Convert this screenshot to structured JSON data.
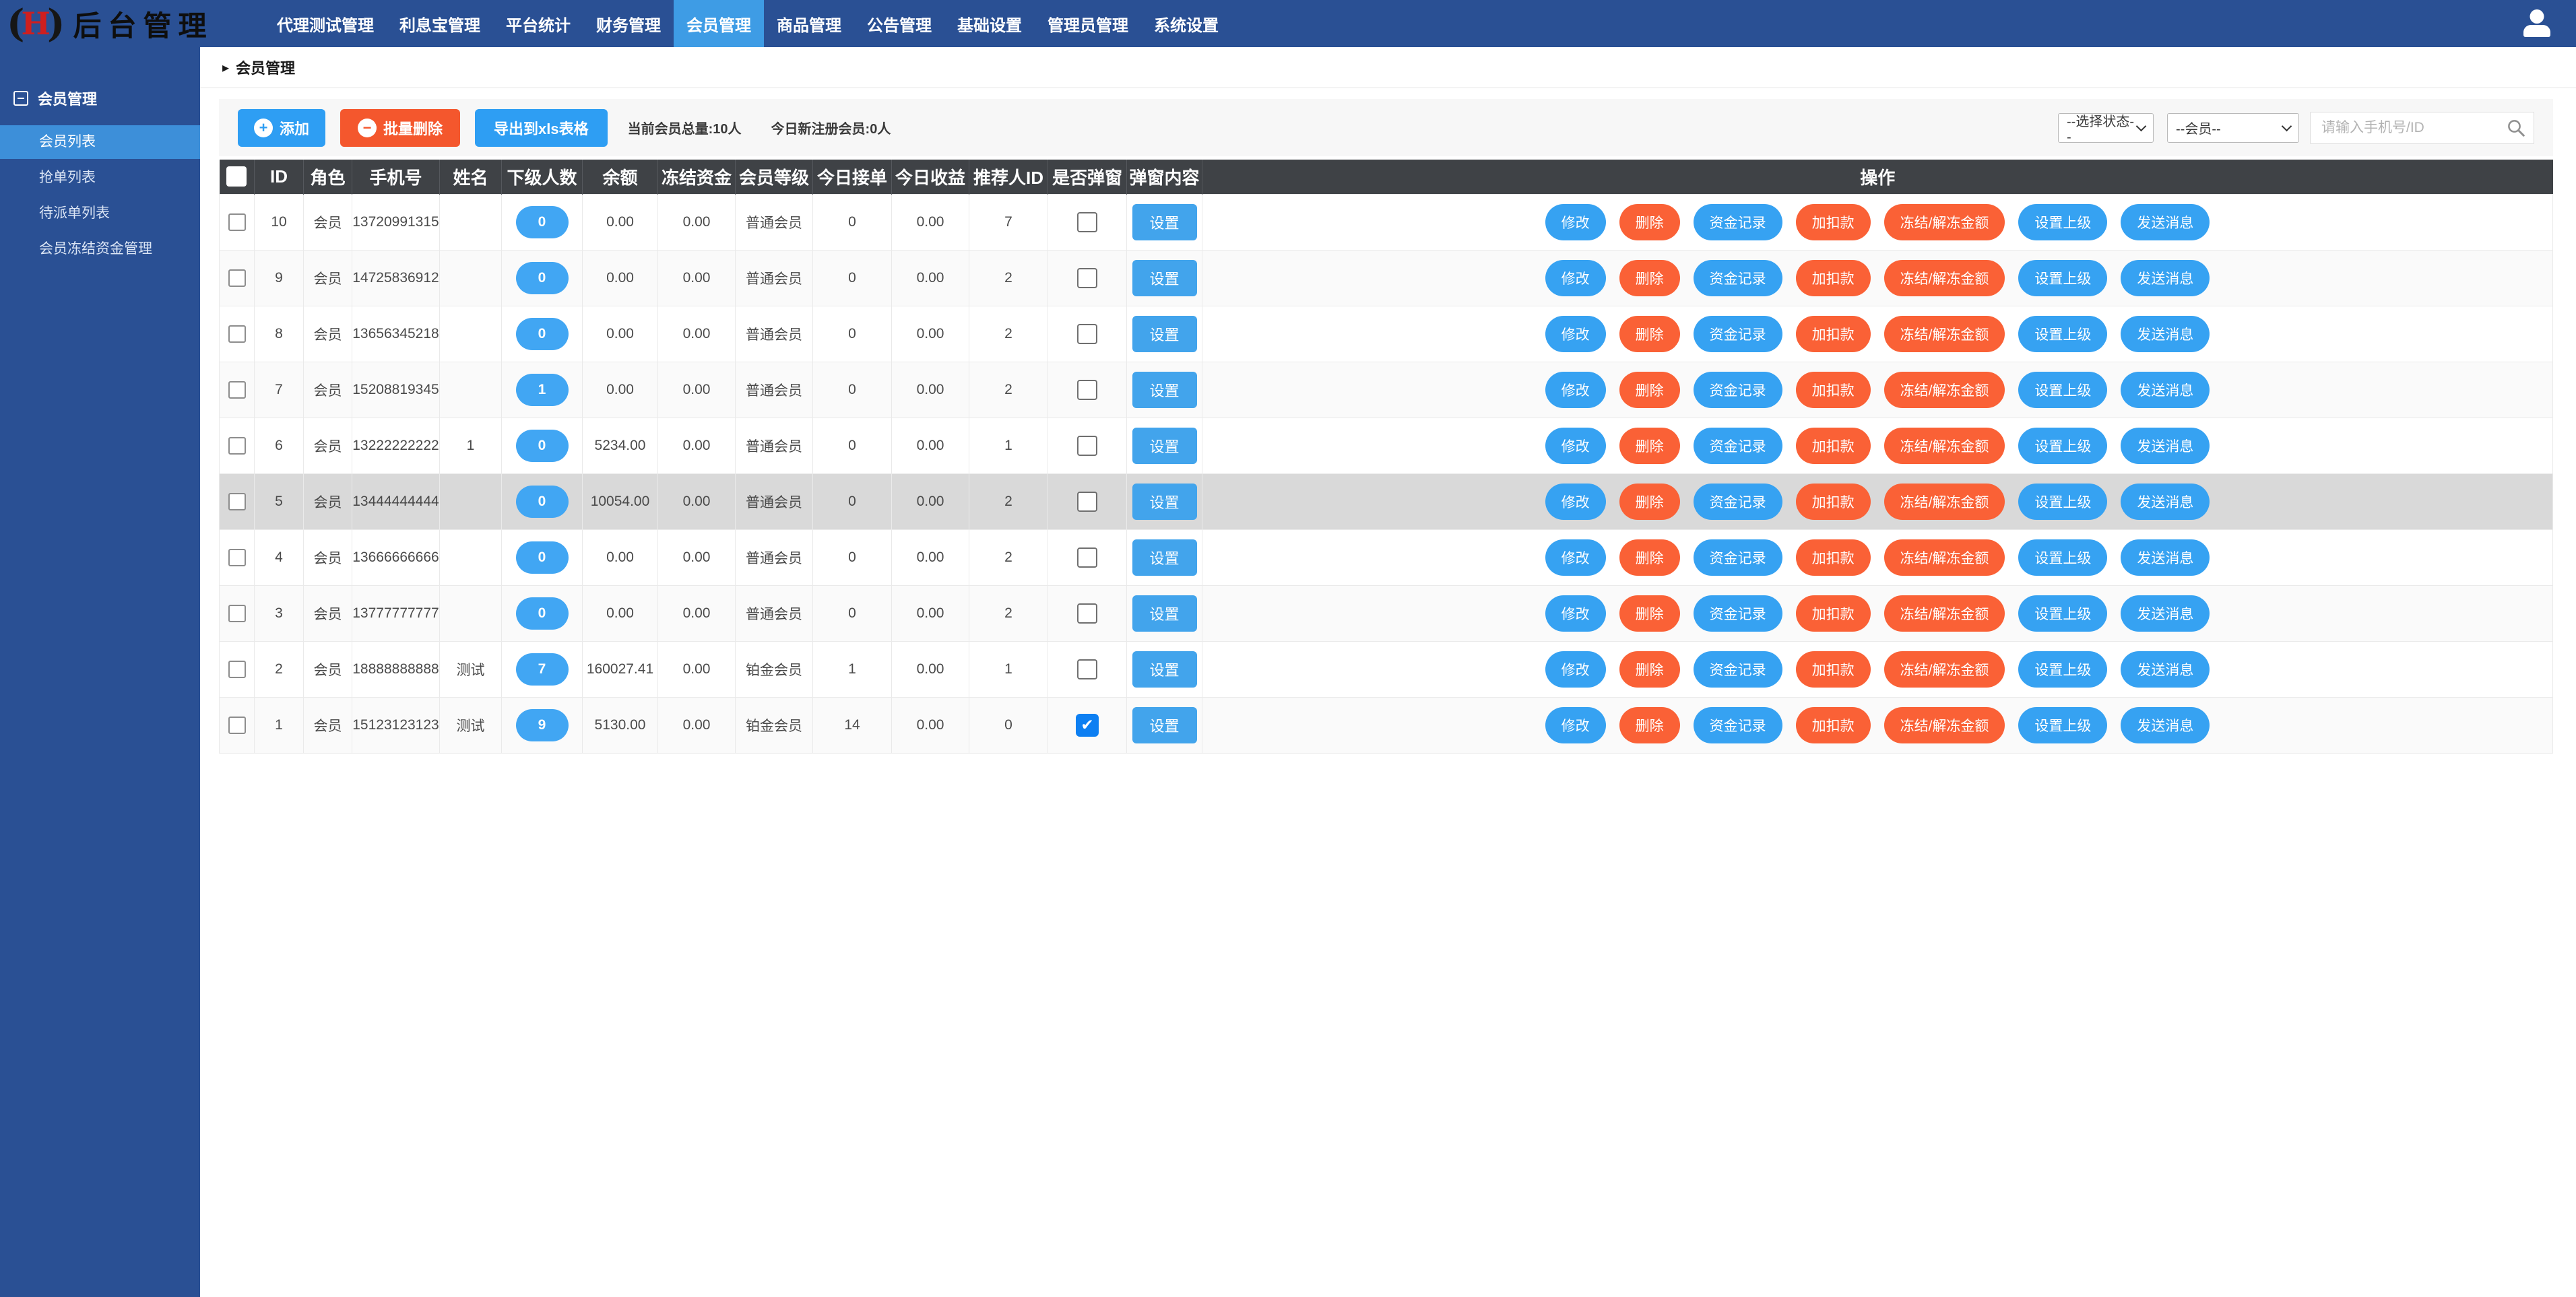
{
  "colors": {
    "navbar_bg": "#2a5094",
    "nav_active_bg": "#3e9ce5",
    "sidebar_active_bg": "#3d8fd9",
    "table_header_bg": "#3f4246",
    "button_blue": "#2e9ef3",
    "button_orange": "#f4572d",
    "pill_blue": "#36a2f2",
    "pill_orange": "#fa6136",
    "badge_blue": "#41a6f3",
    "checkbox_checked_blue": "#0d7ff2",
    "row_highlight_gray": "#d9d9d9"
  },
  "icons": {
    "plus": "+",
    "minus": "−",
    "caret": "▸",
    "check": "✔",
    "logo_letter": "H"
  },
  "navbar": {
    "logo_text": "后台管理",
    "items": [
      {
        "label": "代理测试管理"
      },
      {
        "label": "利息宝管理"
      },
      {
        "label": "平台统计"
      },
      {
        "label": "财务管理"
      },
      {
        "label": "会员管理"
      },
      {
        "label": "商品管理"
      },
      {
        "label": "公告管理"
      },
      {
        "label": "基础设置"
      },
      {
        "label": "管理员管理"
      },
      {
        "label": "系统设置"
      }
    ],
    "active_item": "会员管理"
  },
  "sidebar": {
    "section_title": "会员管理",
    "items": [
      {
        "label": "会员列表"
      },
      {
        "label": "抢单列表"
      },
      {
        "label": "待派单列表"
      },
      {
        "label": "会员冻结资金管理"
      }
    ],
    "active_item": "会员列表"
  },
  "breadcrumb": "会员管理",
  "toolbar": {
    "add_label": "添加",
    "batch_delete_label": "批量删除",
    "export_label": "导出到xls表格",
    "stats_total": "当前会员总量:10人",
    "stats_today": "今日新注册会员:0人",
    "status_select_value": "--选择状态--",
    "member_select_value": "--会员--",
    "search_placeholder": "请输入手机号/ID"
  },
  "table": {
    "headers": [
      "ID",
      "角色",
      "手机号",
      "姓名",
      "下级人数",
      "余额",
      "冻结资金",
      "会员等级",
      "今日接单",
      "今日收益",
      "推荐人ID",
      "是否弹窗",
      "弹窗内容",
      "操作"
    ],
    "set_button": "设置",
    "actions": [
      {
        "label": "修改",
        "style": "blue"
      },
      {
        "label": "删除",
        "style": "orange"
      },
      {
        "label": "资金记录",
        "style": "blue"
      },
      {
        "label": "加扣款",
        "style": "orange"
      },
      {
        "label": "冻结/解冻金额",
        "style": "orange"
      },
      {
        "label": "设置上级",
        "style": "blue"
      },
      {
        "label": "发送消息",
        "style": "blue"
      }
    ],
    "rows": [
      {
        "id": "10",
        "role": "会员",
        "phone": "13720991315",
        "name": "",
        "subordinates": "0",
        "balance": "0.00",
        "frozen": "0.00",
        "level": "普通会员",
        "today_orders": "0",
        "today_income": "0.00",
        "referrer_id": "7",
        "popup": false,
        "highlighted": false
      },
      {
        "id": "9",
        "role": "会员",
        "phone": "14725836912",
        "name": "",
        "subordinates": "0",
        "balance": "0.00",
        "frozen": "0.00",
        "level": "普通会员",
        "today_orders": "0",
        "today_income": "0.00",
        "referrer_id": "2",
        "popup": false,
        "highlighted": false
      },
      {
        "id": "8",
        "role": "会员",
        "phone": "13656345218",
        "name": "",
        "subordinates": "0",
        "balance": "0.00",
        "frozen": "0.00",
        "level": "普通会员",
        "today_orders": "0",
        "today_income": "0.00",
        "referrer_id": "2",
        "popup": false,
        "highlighted": false
      },
      {
        "id": "7",
        "role": "会员",
        "phone": "15208819345",
        "name": "",
        "subordinates": "1",
        "balance": "0.00",
        "frozen": "0.00",
        "level": "普通会员",
        "today_orders": "0",
        "today_income": "0.00",
        "referrer_id": "2",
        "popup": false,
        "highlighted": false
      },
      {
        "id": "6",
        "role": "会员",
        "phone": "13222222222",
        "name": "1",
        "subordinates": "0",
        "balance": "5234.00",
        "frozen": "0.00",
        "level": "普通会员",
        "today_orders": "0",
        "today_income": "0.00",
        "referrer_id": "1",
        "popup": false,
        "highlighted": false
      },
      {
        "id": "5",
        "role": "会员",
        "phone": "13444444444",
        "name": "",
        "subordinates": "0",
        "balance": "10054.00",
        "frozen": "0.00",
        "level": "普通会员",
        "today_orders": "0",
        "today_income": "0.00",
        "referrer_id": "2",
        "popup": false,
        "highlighted": true
      },
      {
        "id": "4",
        "role": "会员",
        "phone": "13666666666",
        "name": "",
        "subordinates": "0",
        "balance": "0.00",
        "frozen": "0.00",
        "level": "普通会员",
        "today_orders": "0",
        "today_income": "0.00",
        "referrer_id": "2",
        "popup": false,
        "highlighted": false
      },
      {
        "id": "3",
        "role": "会员",
        "phone": "13777777777",
        "name": "",
        "subordinates": "0",
        "balance": "0.00",
        "frozen": "0.00",
        "level": "普通会员",
        "today_orders": "0",
        "today_income": "0.00",
        "referrer_id": "2",
        "popup": false,
        "highlighted": false
      },
      {
        "id": "2",
        "role": "会员",
        "phone": "18888888888",
        "name": "测试",
        "subordinates": "7",
        "balance": "160027.41",
        "frozen": "0.00",
        "level": "铂金会员",
        "today_orders": "1",
        "today_income": "0.00",
        "referrer_id": "1",
        "popup": false,
        "highlighted": false
      },
      {
        "id": "1",
        "role": "会员",
        "phone": "15123123123",
        "name": "测试",
        "subordinates": "9",
        "balance": "5130.00",
        "frozen": "0.00",
        "level": "铂金会员",
        "today_orders": "14",
        "today_income": "0.00",
        "referrer_id": "0",
        "popup": true,
        "highlighted": false
      }
    ]
  }
}
